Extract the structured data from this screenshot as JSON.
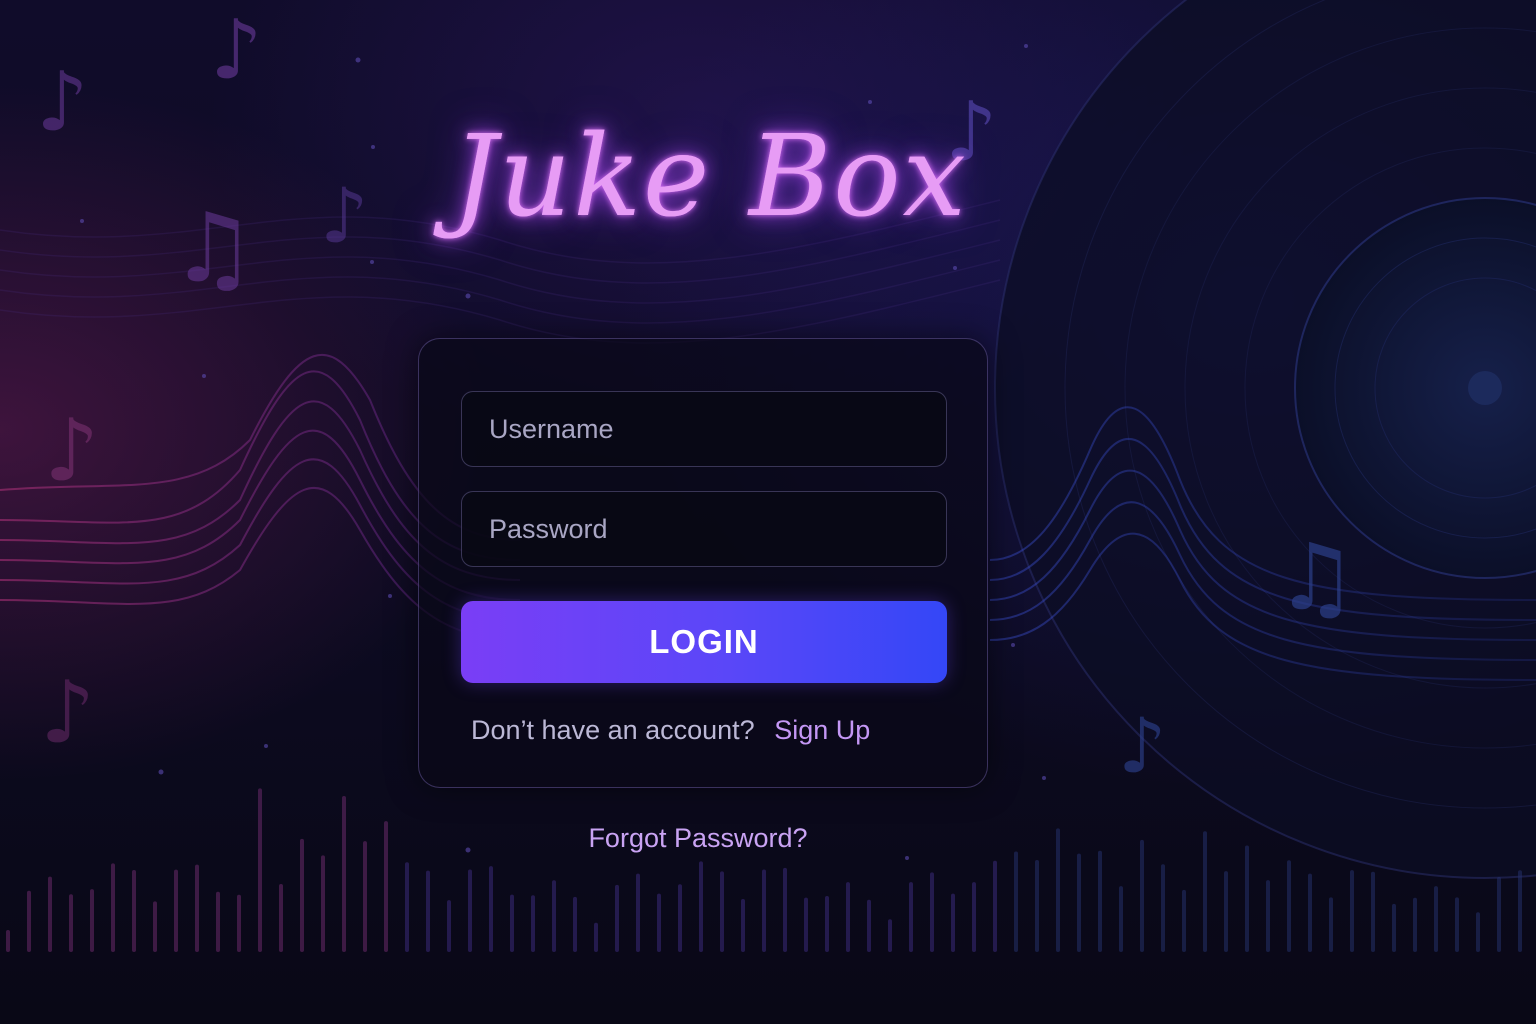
{
  "app": {
    "title": "Juke Box"
  },
  "login_form": {
    "username": {
      "placeholder": "Username",
      "value": ""
    },
    "password": {
      "placeholder": "Password",
      "value": ""
    },
    "login_label": "LOGIN",
    "signup_prompt": "Don’t have an account?",
    "signup_label": "Sign Up"
  },
  "forgot_password_label": "Forgot Password?",
  "decorations": {
    "note_glyph": "♪",
    "beamed_note_glyph": "♫"
  },
  "colors": {
    "background": "#0b0a1c",
    "title_glow": "#e79cf5",
    "button_start": "#7a3ef6",
    "button_end": "#3447f7",
    "link": "#c497f5"
  }
}
